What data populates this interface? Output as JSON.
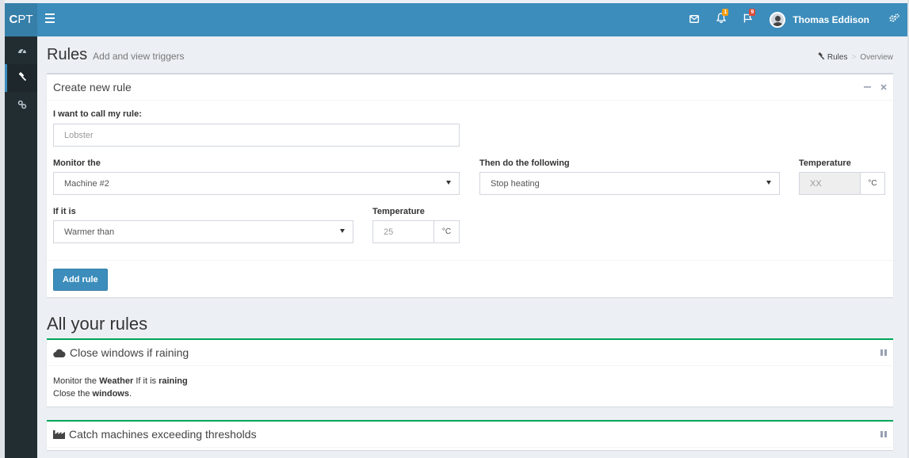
{
  "brand": {
    "bold": "C",
    "rest": "PT"
  },
  "topbar": {
    "notifications": [
      {
        "icon": "envelope-icon",
        "badge": ""
      },
      {
        "icon": "bell-icon",
        "badge": "1",
        "color": "#f39c12"
      },
      {
        "icon": "flag-icon",
        "badge": "9",
        "color": "#dd4b39"
      }
    ],
    "user_name": "Thomas Eddison"
  },
  "sidebar": {
    "items": [
      {
        "icon": "dashboard-icon",
        "active": false
      },
      {
        "icon": "gavel-icon",
        "active": true
      },
      {
        "icon": "link-icon",
        "active": false
      }
    ]
  },
  "page": {
    "title": "Rules",
    "subtitle": "Add and view triggers",
    "breadcrumb": {
      "active": "Rules",
      "sep": ">",
      "current": "Overview"
    }
  },
  "create_rule": {
    "title": "Create new rule",
    "name_label": "I want to call my rule:",
    "name_placeholder": "Lobster",
    "monitor_label": "Monitor the",
    "monitor_value": "Machine #2",
    "then_label": "Then do the following",
    "then_value": "Stop heating",
    "temp_label_right": "Temperature",
    "temp_right_placeholder": "XX",
    "temp_unit_right": "°C",
    "if_label": "If it is",
    "if_value": "Warmer than",
    "temp_label_left": "Temperature",
    "temp_left_placeholder": "25",
    "temp_unit_left": "°C",
    "add_button": "Add rule"
  },
  "rules_section": {
    "title": "All your rules",
    "rules": [
      {
        "title": "Close windows if raining",
        "icon": "cloud-icon",
        "line1": {
          "pre": "Monitor the ",
          "subject": "Weather",
          "mid": " If it is ",
          "condition": "raining"
        },
        "line2": {
          "pre": "Close the ",
          "object": "windows",
          "post": "."
        }
      },
      {
        "title": "Catch machines exceeding thresholds",
        "icon": "industry-icon"
      }
    ]
  },
  "colors": {
    "primary": "#3c8dbc",
    "success": "#00a65a",
    "sidebar": "#222d32"
  }
}
